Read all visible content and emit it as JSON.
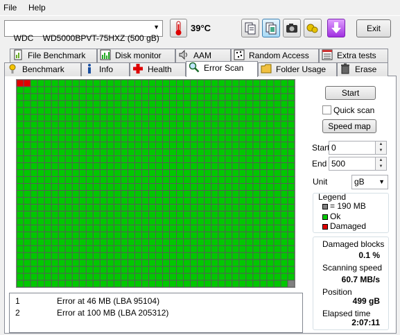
{
  "menu": {
    "file": "File",
    "help": "Help"
  },
  "drive": {
    "selected": "WDC    WD5000BPVT-75HXZ (500 gB)"
  },
  "temperature": "39°C",
  "toolbar": {
    "exit_label": "Exit"
  },
  "tabs_row1": [
    "File Benchmark",
    "Disk monitor",
    "AAM",
    "Random Access",
    "Extra tests"
  ],
  "tabs_row2": [
    "Benchmark",
    "Info",
    "Health",
    "Error Scan",
    "Folder Usage",
    "Erase"
  ],
  "selected_tab": "Error Scan",
  "scan_grid": {
    "columns": 40,
    "rows": 30,
    "damaged_blocks": [
      0,
      1
    ],
    "current_block": 1199
  },
  "log": [
    {
      "num": "1",
      "msg": "Error at 46 MB (LBA 95104)"
    },
    {
      "num": "2",
      "msg": "Error at 100 MB (LBA 205312)"
    }
  ],
  "controls": {
    "start_label": "Start",
    "quick_scan_label": "Quick scan",
    "quick_scan_checked": false,
    "speed_map_label": "Speed map",
    "start_field_label": "Start",
    "start_value": "0",
    "end_field_label": "End",
    "end_value": "500",
    "unit_label": "Unit",
    "unit_value": "gB"
  },
  "legend": {
    "title": "Legend",
    "items": [
      {
        "label": "= 190 MB",
        "color": "#808080"
      },
      {
        "label": "Ok",
        "color": "#00c800"
      },
      {
        "label": "Damaged",
        "color": "#e00000"
      }
    ]
  },
  "stats": {
    "damaged_label": "Damaged blocks",
    "damaged_value": "0.1 %",
    "speed_label": "Scanning speed",
    "speed_value": "60.7 MB/s",
    "position_label": "Position",
    "position_value": "499 gB",
    "elapsed_label": "Elapsed time",
    "elapsed_value": "2:07:11"
  },
  "colors": {
    "ok": "#00c800",
    "damaged": "#e00000",
    "current": "#808080",
    "grid_line": "#5a5a5a"
  }
}
